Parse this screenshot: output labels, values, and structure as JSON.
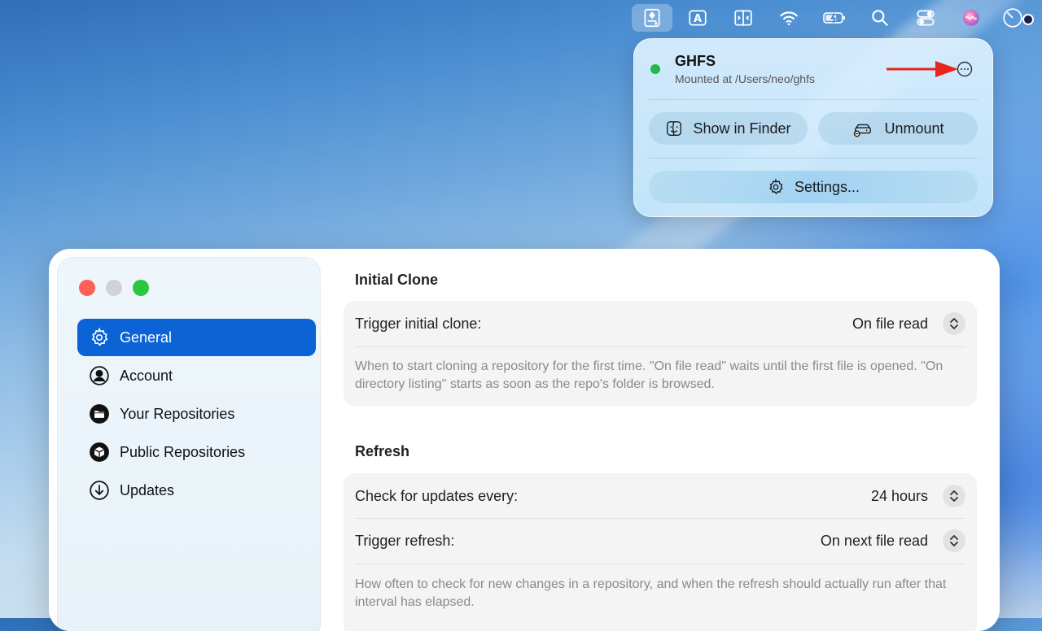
{
  "menubar": {
    "items": [
      {
        "icon": "drive-icon",
        "active": true
      },
      {
        "icon": "text-input-icon"
      },
      {
        "icon": "sidebar-toggle-icon"
      },
      {
        "icon": "wifi-icon"
      },
      {
        "icon": "battery-charging-icon"
      },
      {
        "icon": "search-icon"
      },
      {
        "icon": "control-center-icon"
      },
      {
        "icon": "siri-icon"
      },
      {
        "icon": "clock-icon"
      }
    ],
    "text_input_letter": "A"
  },
  "popover": {
    "title": "GHFS",
    "subtitle": "Mounted at /Users/neo/ghfs",
    "status_color": "#1fba4a",
    "show_in_finder_label": "Show in Finder",
    "unmount_label": "Unmount",
    "settings_label": "Settings..."
  },
  "sidebar": {
    "items": [
      {
        "label": "General",
        "icon": "gear-icon",
        "selected": true
      },
      {
        "label": "Account",
        "icon": "person-circle-icon"
      },
      {
        "label": "Your Repositories",
        "icon": "folder-icon"
      },
      {
        "label": "Public Repositories",
        "icon": "globe-box-icon"
      },
      {
        "label": "Updates",
        "icon": "download-icon"
      }
    ]
  },
  "sections": {
    "initial_clone": {
      "title": "Initial Clone",
      "rows": [
        {
          "label": "Trigger initial clone:",
          "value": "On file read"
        }
      ],
      "help": "When to start cloning a repository for the first time. \"On file read\" waits until the first file is opened. \"On directory listing\" starts as soon as the repo's folder is browsed."
    },
    "refresh": {
      "title": "Refresh",
      "rows": [
        {
          "label": "Check for updates every:",
          "value": "24 hours"
        },
        {
          "label": "Trigger refresh:",
          "value": "On next file read"
        }
      ],
      "help": "How often to check for new changes in a repository, and when the refresh should actually run after that interval has elapsed."
    }
  },
  "colors": {
    "accent": "#0b63d6",
    "close": "#fe5f57",
    "minimize": "#d1d1d6",
    "maximize": "#29c840",
    "annotation_arrow": "#e8251c"
  }
}
